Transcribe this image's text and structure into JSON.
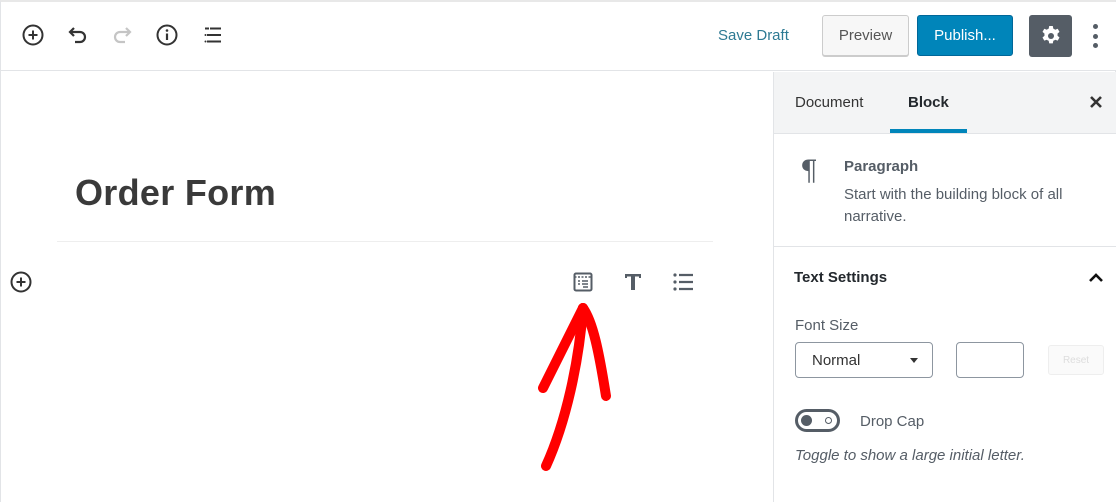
{
  "toolbar": {
    "left_icons": [
      {
        "name": "add-block-icon"
      },
      {
        "name": "undo-icon"
      },
      {
        "name": "redo-icon"
      },
      {
        "name": "info-icon"
      },
      {
        "name": "block-navigation-icon"
      }
    ],
    "save_draft_label": "Save Draft",
    "preview_label": "Preview",
    "publish_label": "Publish...",
    "settings_icon": "gear-icon",
    "more_icon": "more-vertical-icon",
    "colors": {
      "publish": "#0085ba",
      "settings_bg": "#555d66",
      "save_draft": "#2e7a93"
    }
  },
  "editor": {
    "post_title": "Order Form",
    "quick_inserter_icons": [
      "form-block-icon",
      "heading-block-icon",
      "list-block-icon"
    ],
    "annotation": "red-arrow-pointing-to-form-block-icon"
  },
  "sidebar": {
    "tabs": [
      {
        "label": "Document",
        "active": false
      },
      {
        "label": "Block",
        "active": true
      }
    ],
    "block": {
      "icon": "¶",
      "name": "Paragraph",
      "description": "Start with the building block of all narrative."
    },
    "text_settings": {
      "title": "Text Settings",
      "expanded": true,
      "font_size_label": "Font Size",
      "font_size_selected": "Normal",
      "custom_size_value": "",
      "reset_label": "Reset",
      "drop_cap_label": "Drop Cap",
      "drop_cap_enabled": false,
      "drop_cap_help": "Toggle to show a large initial letter."
    }
  }
}
